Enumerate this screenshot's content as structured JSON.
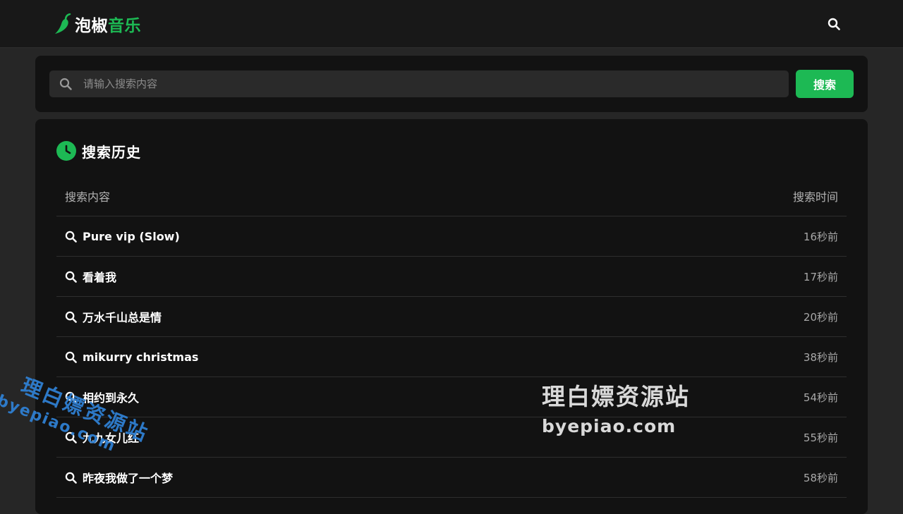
{
  "header": {
    "logo_part1": "泡椒",
    "logo_part2": "音乐",
    "icon": "search-icon"
  },
  "search": {
    "placeholder": "请输入搜索内容",
    "value": "",
    "button_label": "搜索"
  },
  "history": {
    "title": "搜索历史",
    "col_content": "搜索内容",
    "col_time": "搜索时间",
    "rows": [
      {
        "query": "Pure vip (Slow)",
        "time": "16秒前"
      },
      {
        "query": "看着我",
        "time": "17秒前"
      },
      {
        "query": "万水千山总是情",
        "time": "20秒前"
      },
      {
        "query": "mikurry christmas",
        "time": "38秒前"
      },
      {
        "query": "相约到永久",
        "time": "54秒前"
      },
      {
        "query": "九九女儿红",
        "time": "55秒前"
      },
      {
        "query": "昨夜我做了一个梦",
        "time": "58秒前"
      }
    ]
  },
  "watermark": {
    "name": "理白嫖资源站",
    "domain": "byepiao.com"
  },
  "colors": {
    "accent": "#1db954",
    "background": "#262626",
    "card": "#121212"
  }
}
